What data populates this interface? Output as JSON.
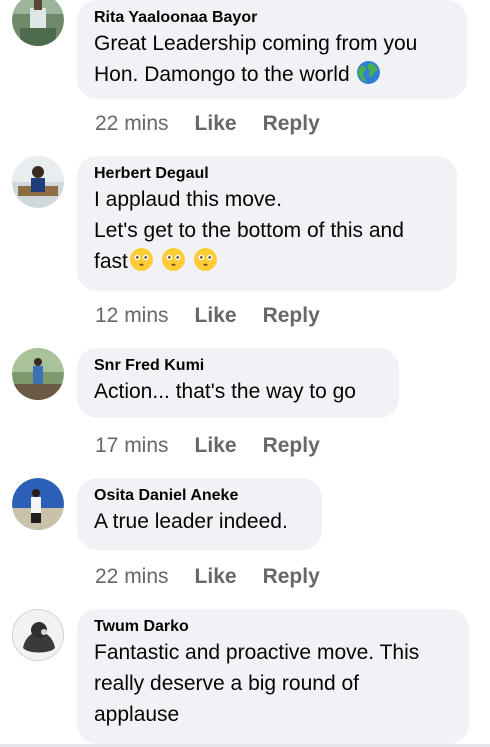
{
  "comments": [
    {
      "author": "Rita Yaaloonaa Bayor",
      "lines": [
        "Great Leadership coming from you",
        "Hon. Damongo to the world"
      ],
      "emoji": "globe-icon",
      "time": "22 mins",
      "like": "Like",
      "reply": "Reply"
    },
    {
      "author": "Herbert Degaul",
      "lines": [
        "I applaud this move.",
        "Let's get to the bottom of this and",
        "fast"
      ],
      "emoji": "flushed-face-icon",
      "time": "12 mins",
      "like": "Like",
      "reply": "Reply"
    },
    {
      "author": "Snr Fred Kumi",
      "lines": [
        "Action... that's the way to go"
      ],
      "time": "17 mins",
      "like": "Like",
      "reply": "Reply"
    },
    {
      "author": "Osita Daniel Aneke",
      "lines": [
        "A true leader indeed."
      ],
      "time": "22 mins",
      "like": "Like",
      "reply": "Reply"
    },
    {
      "author": "Twum Darko",
      "lines": [
        "Fantastic and proactive move. This",
        "really deserve a big round of",
        "applause"
      ]
    }
  ],
  "colors": {
    "bubble": "#f0f2f5",
    "secondary_text": "#65676b",
    "primary_text": "#050505"
  }
}
